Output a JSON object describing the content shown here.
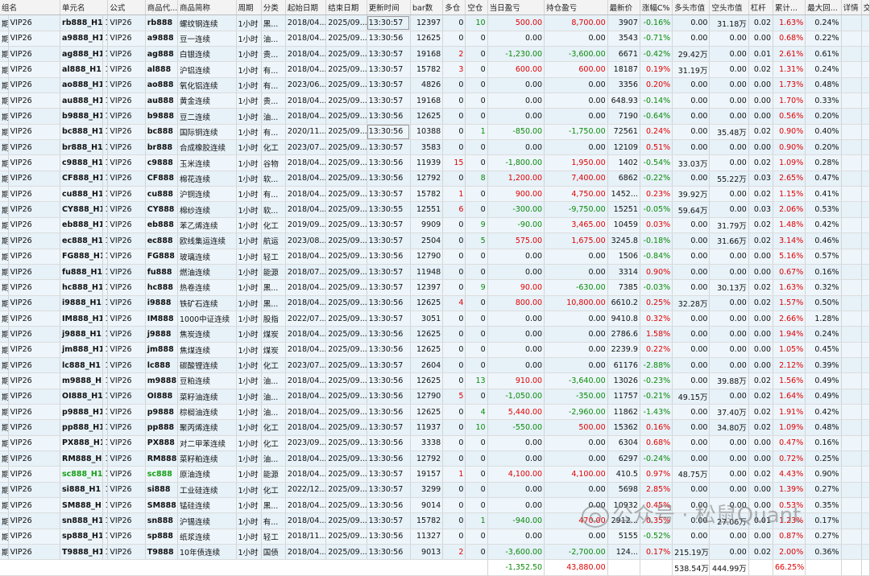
{
  "columns": [
    "组名",
    "单元名",
    "公式",
    "商品代...",
    "商品简称",
    "周期",
    "分类",
    "起始日期",
    "结束日期",
    "更新时间",
    "bar数",
    "多仓",
    "空仓",
    "当日盈亏",
    "持仓盈亏",
    "最新价",
    "涨幅C%",
    "多头市值",
    "空头市值",
    "杠杆",
    "累计...",
    "最大回...",
    "详情",
    "交"
  ],
  "rows": [
    [
      "期",
      "VIP26",
      "rb888_H1",
      "1",
      "VIP26",
      "rb888",
      "螺纹钢连续",
      "1小时",
      "黑...",
      "2018/04...",
      "2025/09...",
      "13:30:57",
      "12397",
      "0",
      "10",
      "500.00",
      "8,700.00",
      "3907",
      "-0.16%",
      "0.00",
      "31.18万",
      "0.02",
      "1.63%",
      "0.24%",
      "",
      ""
    ],
    [
      "期",
      "VIP26",
      "a9888_H1",
      "1",
      "VIP26",
      "a9888",
      "豆一连续",
      "1小时",
      "油...",
      "2018/04...",
      "2025/09...",
      "13:30:56",
      "12625",
      "0",
      "0",
      "0.00",
      "0.00",
      "3543",
      "-0.71%",
      "0.00",
      "0.00",
      "0.00",
      "0.68%",
      "0.22%",
      "",
      ""
    ],
    [
      "期",
      "VIP26",
      "ag888_H1",
      "1",
      "VIP26",
      "ag888",
      "白银连续",
      "1小时",
      "贵...",
      "2018/04...",
      "2025/09...",
      "13:30:57",
      "19168",
      "2",
      "0",
      "-1,230.00",
      "-3,600.00",
      "6671",
      "-0.42%",
      "29.42万",
      "0.00",
      "0.01",
      "2.61%",
      "0.61%",
      "",
      ""
    ],
    [
      "期",
      "VIP26",
      "al888_H1",
      "1",
      "VIP26",
      "al888",
      "沪铝连续",
      "1小时",
      "有...",
      "2018/04...",
      "2025/09...",
      "13:30:57",
      "15782",
      "3",
      "0",
      "600.00",
      "600.00",
      "18187",
      "0.19%",
      "31.19万",
      "0.00",
      "0.02",
      "1.31%",
      "0.24%",
      "",
      ""
    ],
    [
      "期",
      "VIP26",
      "ao888_H1",
      "1",
      "VIP26",
      "ao888",
      "氧化铝连续",
      "1小时",
      "有...",
      "2023/06...",
      "2025/09...",
      "13:30:57",
      "4826",
      "0",
      "0",
      "0.00",
      "0.00",
      "3356",
      "0.20%",
      "0.00",
      "0.00",
      "0.00",
      "1.73%",
      "0.48%",
      "",
      ""
    ],
    [
      "期",
      "VIP26",
      "au888_H1",
      "1",
      "VIP26",
      "au888",
      "黄金连续",
      "1小时",
      "贵...",
      "2018/04...",
      "2025/09...",
      "13:30:57",
      "19168",
      "0",
      "0",
      "0.00",
      "0.00",
      "648.93",
      "-0.14%",
      "0.00",
      "0.00",
      "0.00",
      "1.70%",
      "0.33%",
      "",
      ""
    ],
    [
      "期",
      "VIP26",
      "b9888_H1",
      "1",
      "VIP26",
      "b9888",
      "豆二连续",
      "1小时",
      "油...",
      "2018/04...",
      "2025/09...",
      "13:30:56",
      "12625",
      "0",
      "0",
      "0.00",
      "0.00",
      "7190",
      "-0.64%",
      "0.00",
      "0.00",
      "0.00",
      "0.56%",
      "0.20%",
      "",
      ""
    ],
    [
      "期",
      "VIP26",
      "bc888_H1",
      "1",
      "VIP26",
      "bc888",
      "国际铜连续",
      "1小时",
      "有...",
      "2020/11...",
      "2025/09...",
      "13:30:56",
      "10388",
      "0",
      "1",
      "-850.00",
      "-1,750.00",
      "72561",
      "0.24%",
      "0.00",
      "35.48万",
      "0.02",
      "0.90%",
      "0.40%",
      "",
      ""
    ],
    [
      "期",
      "VIP26",
      "br888_H1",
      "1",
      "VIP26",
      "br888",
      "合成橡胶连续",
      "1小时",
      "化工",
      "2023/07...",
      "2025/09...",
      "13:30:57",
      "3583",
      "0",
      "0",
      "0.00",
      "0.00",
      "12109",
      "0.51%",
      "0.00",
      "0.00",
      "0.00",
      "0.90%",
      "0.20%",
      "",
      ""
    ],
    [
      "期",
      "VIP26",
      "c9888_H1",
      "1",
      "VIP26",
      "c9888",
      "玉米连续",
      "1小时",
      "谷物",
      "2018/04...",
      "2025/09...",
      "13:30:56",
      "11939",
      "15",
      "0",
      "-1,800.00",
      "1,950.00",
      "1402",
      "-0.54%",
      "33.03万",
      "0.00",
      "0.02",
      "1.09%",
      "0.28%",
      "",
      ""
    ],
    [
      "期",
      "VIP26",
      "CF888_H1",
      "1",
      "VIP26",
      "CF888",
      "棉花连续",
      "1小时",
      "软...",
      "2018/04...",
      "2025/09...",
      "13:30:56",
      "12792",
      "0",
      "8",
      "1,200.00",
      "7,400.00",
      "6862",
      "-0.22%",
      "0.00",
      "55.22万",
      "0.03",
      "2.65%",
      "0.47%",
      "",
      ""
    ],
    [
      "期",
      "VIP26",
      "cu888_H1",
      "1",
      "VIP26",
      "cu888",
      "沪铜连续",
      "1小时",
      "有...",
      "2018/04...",
      "2025/09...",
      "13:30:57",
      "15782",
      "1",
      "0",
      "900.00",
      "4,750.00",
      "1452...",
      "0.23%",
      "39.92万",
      "0.00",
      "0.02",
      "1.15%",
      "0.41%",
      "",
      ""
    ],
    [
      "期",
      "VIP26",
      "CY888_H1",
      "1",
      "VIP26",
      "CY888",
      "棉纱连续",
      "1小时",
      "软...",
      "2018/04...",
      "2025/09...",
      "13:30:55",
      "12551",
      "6",
      "0",
      "-300.00",
      "-9,750.00",
      "15251",
      "-0.05%",
      "59.64万",
      "0.00",
      "0.03",
      "2.06%",
      "0.53%",
      "",
      ""
    ],
    [
      "期",
      "VIP26",
      "eb888_H1",
      "1",
      "VIP26",
      "eb888",
      "苯乙烯连续",
      "1小时",
      "化工",
      "2019/09...",
      "2025/09...",
      "13:30:57",
      "9909",
      "0",
      "9",
      "-90.00",
      "3,465.00",
      "10459",
      "0.03%",
      "0.00",
      "31.79万",
      "0.02",
      "1.48%",
      "0.42%",
      "",
      ""
    ],
    [
      "期",
      "VIP26",
      "ec888_H1",
      "1",
      "VIP26",
      "ec888",
      "欧线集运连续",
      "1小时",
      "航运",
      "2023/08...",
      "2025/09...",
      "13:30:57",
      "2504",
      "0",
      "5",
      "575.00",
      "1,675.00",
      "3245.8",
      "-0.18%",
      "0.00",
      "31.66万",
      "0.02",
      "3.14%",
      "0.46%",
      "",
      ""
    ],
    [
      "期",
      "VIP26",
      "FG888_H1",
      "1",
      "VIP26",
      "FG888",
      "玻璃连续",
      "1小时",
      "轻工",
      "2018/04...",
      "2025/09...",
      "13:30:56",
      "12790",
      "0",
      "0",
      "0.00",
      "0.00",
      "1506",
      "-0.84%",
      "0.00",
      "0.00",
      "0.00",
      "5.16%",
      "0.57%",
      "",
      ""
    ],
    [
      "期",
      "VIP26",
      "fu888_H1",
      "1",
      "VIP26",
      "fu888",
      "燃油连续",
      "1小时",
      "能源",
      "2018/07...",
      "2025/09...",
      "13:30:57",
      "11948",
      "0",
      "0",
      "0.00",
      "0.00",
      "3314",
      "0.90%",
      "0.00",
      "0.00",
      "0.00",
      "0.67%",
      "0.16%",
      "",
      ""
    ],
    [
      "期",
      "VIP26",
      "hc888_H1",
      "1",
      "VIP26",
      "hc888",
      "热卷连续",
      "1小时",
      "黑...",
      "2018/04...",
      "2025/09...",
      "13:30:57",
      "12397",
      "0",
      "9",
      "90.00",
      "-630.00",
      "7385",
      "-0.03%",
      "0.00",
      "30.13万",
      "0.02",
      "1.63%",
      "0.32%",
      "",
      ""
    ],
    [
      "期",
      "VIP26",
      "i9888_H1",
      "1",
      "VIP26",
      "i9888",
      "铁矿石连续",
      "1小时",
      "黑...",
      "2018/04...",
      "2025/09...",
      "13:30:56",
      "12625",
      "4",
      "0",
      "800.00",
      "10,800.00",
      "6610.2",
      "0.25%",
      "32.28万",
      "0.00",
      "0.02",
      "1.57%",
      "0.50%",
      "",
      ""
    ],
    [
      "期",
      "VIP26",
      "IM888_H1",
      "1",
      "VIP26",
      "IM888",
      "1000中证连续",
      "1小时",
      "股指",
      "2022/07...",
      "2025/09...",
      "13:30:57",
      "3051",
      "0",
      "0",
      "0.00",
      "0.00",
      "9410.8",
      "0.32%",
      "0.00",
      "0.00",
      "0.00",
      "2.66%",
      "1.28%",
      "",
      ""
    ],
    [
      "期",
      "VIP26",
      "j9888_H1",
      "1",
      "VIP26",
      "j9888",
      "焦炭连续",
      "1小时",
      "煤炭",
      "2018/04...",
      "2025/09...",
      "13:30:56",
      "12625",
      "0",
      "0",
      "0.00",
      "0.00",
      "2786.6",
      "1.58%",
      "0.00",
      "0.00",
      "0.00",
      "1.94%",
      "0.24%",
      "",
      ""
    ],
    [
      "期",
      "VIP26",
      "jm888_H1",
      "1",
      "VIP26",
      "jm888",
      "焦煤连续",
      "1小时",
      "煤炭",
      "2018/04...",
      "2025/09...",
      "13:30:56",
      "12625",
      "0",
      "0",
      "0.00",
      "0.00",
      "2239.9",
      "0.22%",
      "0.00",
      "0.00",
      "0.00",
      "1.05%",
      "0.45%",
      "",
      ""
    ],
    [
      "期",
      "VIP26",
      "lc888_H1",
      "1",
      "VIP26",
      "lc888",
      "碳酸锂连续",
      "1小时",
      "化工",
      "2023/07...",
      "2025/09...",
      "13:30:57",
      "2604",
      "0",
      "0",
      "0.00",
      "0.00",
      "61176",
      "-2.88%",
      "0.00",
      "0.00",
      "0.00",
      "2.12%",
      "0.39%",
      "",
      ""
    ],
    [
      "期",
      "VIP26",
      "m9888_H1",
      "1",
      "VIP26",
      "m9888",
      "豆粕连续",
      "1小时",
      "油...",
      "2018/04...",
      "2025/09...",
      "13:30:56",
      "12625",
      "0",
      "13",
      "910.00",
      "-3,640.00",
      "13026",
      "-0.23%",
      "0.00",
      "39.88万",
      "0.02",
      "1.56%",
      "0.49%",
      "",
      ""
    ],
    [
      "期",
      "VIP26",
      "OI888_H1",
      "1",
      "VIP26",
      "OI888",
      "菜籽油连续",
      "1小时",
      "油...",
      "2018/04...",
      "2025/09...",
      "13:30:56",
      "12790",
      "5",
      "0",
      "-1,050.00",
      "-350.00",
      "11757",
      "-0.21%",
      "49.15万",
      "0.00",
      "0.02",
      "1.64%",
      "0.49%",
      "",
      ""
    ],
    [
      "期",
      "VIP26",
      "p9888_H1",
      "1",
      "VIP26",
      "p9888",
      "棕榈油连续",
      "1小时",
      "油...",
      "2018/04...",
      "2025/09...",
      "13:30:56",
      "12625",
      "0",
      "4",
      "5,440.00",
      "-2,960.00",
      "11862",
      "-1.43%",
      "0.00",
      "37.40万",
      "0.02",
      "1.91%",
      "0.42%",
      "",
      ""
    ],
    [
      "期",
      "VIP26",
      "pp888_H1",
      "1",
      "VIP26",
      "pp888",
      "聚丙烯连续",
      "1小时",
      "化工",
      "2018/04...",
      "2025/09...",
      "13:30:57",
      "11937",
      "0",
      "10",
      "-550.00",
      "500.00",
      "15362",
      "0.16%",
      "0.00",
      "34.80万",
      "0.02",
      "1.09%",
      "0.48%",
      "",
      ""
    ],
    [
      "期",
      "VIP26",
      "PX888_H1",
      "1",
      "VIP26",
      "PX888",
      "对二甲苯连续",
      "1小时",
      "化工",
      "2023/09...",
      "2025/09...",
      "13:30:56",
      "3338",
      "0",
      "0",
      "0.00",
      "0.00",
      "6304",
      "0.68%",
      "0.00",
      "0.00",
      "0.00",
      "0.47%",
      "0.16%",
      "",
      ""
    ],
    [
      "期",
      "VIP26",
      "RM888_H1",
      "1",
      "VIP26",
      "RM888",
      "菜籽粕连续",
      "1小时",
      "油...",
      "2018/04...",
      "2025/09...",
      "13:30:56",
      "12792",
      "0",
      "0",
      "0.00",
      "0.00",
      "6297",
      "-0.24%",
      "0.00",
      "0.00",
      "0.00",
      "0.72%",
      "0.25%",
      "",
      ""
    ],
    [
      "期",
      "VIP26",
      "sc888_H1",
      "1",
      "VIP26",
      "sc888",
      "原油连续",
      "1小时",
      "能源",
      "2018/04...",
      "2025/09...",
      "13:30:57",
      "19157",
      "1",
      "0",
      "4,100.00",
      "4,100.00",
      "410.5",
      "0.97%",
      "48.75万",
      "0.00",
      "0.02",
      "4.43%",
      "0.90%",
      "",
      ""
    ],
    [
      "期",
      "VIP26",
      "si888_H1",
      "1",
      "VIP26",
      "si888",
      "工业硅连续",
      "1小时",
      "化工",
      "2022/12...",
      "2025/09...",
      "13:30:57",
      "3299",
      "0",
      "0",
      "0.00",
      "0.00",
      "5698",
      "2.85%",
      "0.00",
      "0.00",
      "0.00",
      "1.39%",
      "0.27%",
      "",
      ""
    ],
    [
      "期",
      "VIP26",
      "SM888_H1",
      "1",
      "VIP26",
      "SM888",
      "锰硅连续",
      "1小时",
      "黑...",
      "2018/04...",
      "2025/09...",
      "13:30:56",
      "9014",
      "0",
      "0",
      "0.00",
      "0.00",
      "10932",
      "0.45%",
      "0.00",
      "0.00",
      "0.00",
      "0.53%",
      "0.35%",
      "",
      ""
    ],
    [
      "期",
      "VIP26",
      "sn888_H1",
      "1",
      "VIP26",
      "sn888",
      "沪锡连续",
      "1小时",
      "有...",
      "2018/04...",
      "2025/09...",
      "13:30:57",
      "15782",
      "0",
      "1",
      "-940.00",
      "470.00",
      "2912...",
      "0.35%",
      "0.00",
      "27.06万",
      "0.01",
      "1.23%",
      "0.17%",
      "",
      ""
    ],
    [
      "期",
      "VIP26",
      "sp888_H1",
      "1",
      "VIP26",
      "sp888",
      "纸浆连续",
      "1小时",
      "轻工",
      "2018/11...",
      "2025/09...",
      "13:30:56",
      "11327",
      "0",
      "0",
      "0.00",
      "0.00",
      "5155",
      "-0.52%",
      "0.00",
      "0.00",
      "0.00",
      "0.87%",
      "0.27%",
      "",
      ""
    ],
    [
      "期",
      "VIP26",
      "T9888_H1",
      "1",
      "VIP26",
      "T9888",
      "10年债连续",
      "1小时",
      "国债",
      "2018/04...",
      "2025/09...",
      "13:30:56",
      "9013",
      "2",
      "0",
      "-3,600.00",
      "-2,700.00",
      "124...",
      "0.17%",
      "215.19万",
      "0.00",
      "0.02",
      "2.00%",
      "0.36%",
      "",
      ""
    ]
  ],
  "footer": {
    "daily_pnl": "-1,352.50",
    "position_pnl": "43,880.00",
    "long_value": "538.54万",
    "short_value": "444.99万",
    "cumulative": "66.25%"
  },
  "watermark": {
    "text": "公众号 · 松鼠Quant"
  }
}
